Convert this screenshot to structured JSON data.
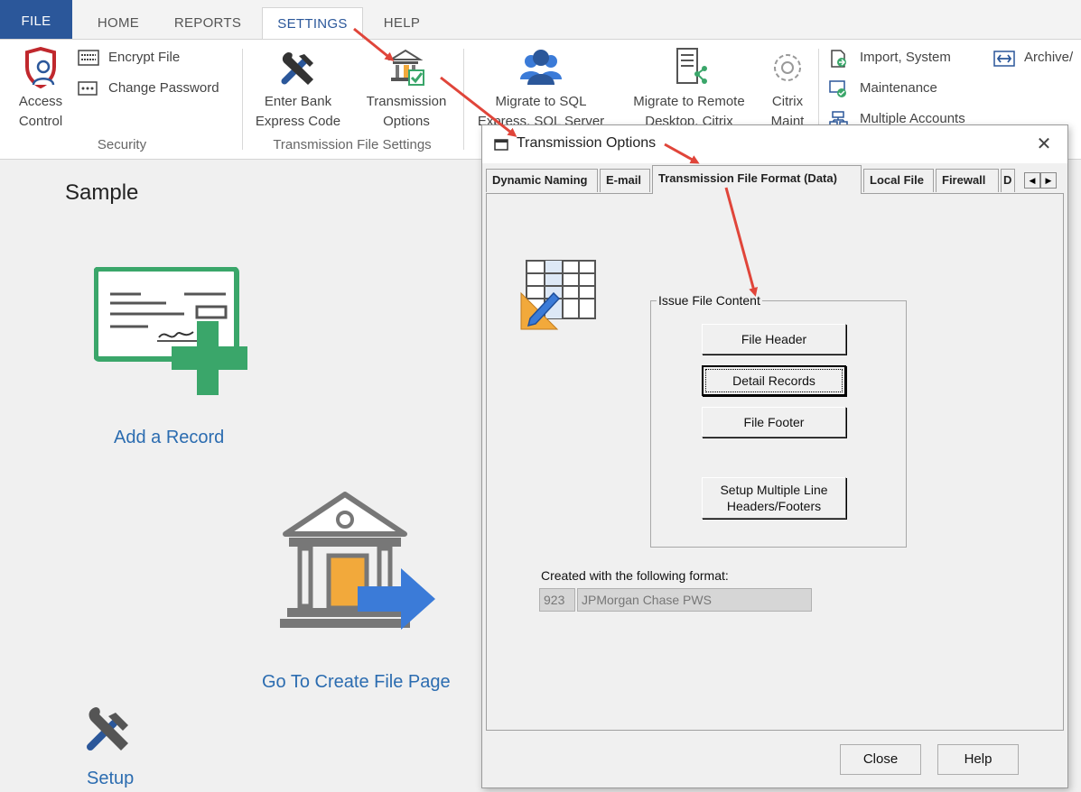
{
  "ribbon_tabs": [
    {
      "label": "FILE"
    },
    {
      "label": "HOME"
    },
    {
      "label": "REPORTS"
    },
    {
      "label": "SETTINGS"
    },
    {
      "label": "HELP"
    }
  ],
  "ribbon": {
    "access_control": {
      "line1": "Access",
      "line2": "Control"
    },
    "encrypt_file": "Encrypt File",
    "change_password": "Change Password",
    "security_group": "Security",
    "enter_bank": {
      "line1": "Enter Bank",
      "line2": "Express Code"
    },
    "transmission_options": {
      "line1": "Transmission",
      "line2": "Options"
    },
    "transmission_group": "Transmission File Settings",
    "migrate_sql": {
      "line1": "Migrate to SQL",
      "line2": "Express, SQL Server"
    },
    "migrate_remote": {
      "line1": "Migrate to Remote",
      "line2": "Desktop, Citrix"
    },
    "citrix_maint": {
      "line1": "Citrix",
      "line2": "Maint"
    },
    "import_system": "Import, System",
    "maintenance": "Maintenance",
    "multiple_accounts": "Multiple Accounts",
    "archive": "Archive/"
  },
  "main": {
    "title": "Sample",
    "add_record": "Add a Record",
    "create_file": "Go To Create File Page",
    "setup": "Setup"
  },
  "dialog": {
    "title": "Transmission Options",
    "close_symbol": "✕",
    "tabs": [
      {
        "label": "Dynamic Naming"
      },
      {
        "label": "E-mail"
      },
      {
        "label": "Transmission File Format (Data)"
      },
      {
        "label": "Local File"
      },
      {
        "label": "Firewall"
      },
      {
        "label": "D"
      }
    ],
    "group_label": "Issue File Content",
    "buttons": {
      "file_header": "File Header",
      "detail_records": "Detail Records",
      "file_footer": "File Footer",
      "setup_multiple_line1": "Setup Multiple Line",
      "setup_multiple_line2": "Headers/Footers"
    },
    "format_label": "Created with the following format:",
    "format_code": "923",
    "format_name": "JPMorgan Chase PWS",
    "close_button": "Close",
    "help_button": "Help"
  },
  "colors": {
    "file_tab": "#2b579a",
    "accent_blue": "#2b6cb0",
    "arrow_red": "#e0453a",
    "icon_green": "#3aa66a",
    "icon_orange": "#f2a93b",
    "icon_blue": "#3b7bd8"
  }
}
